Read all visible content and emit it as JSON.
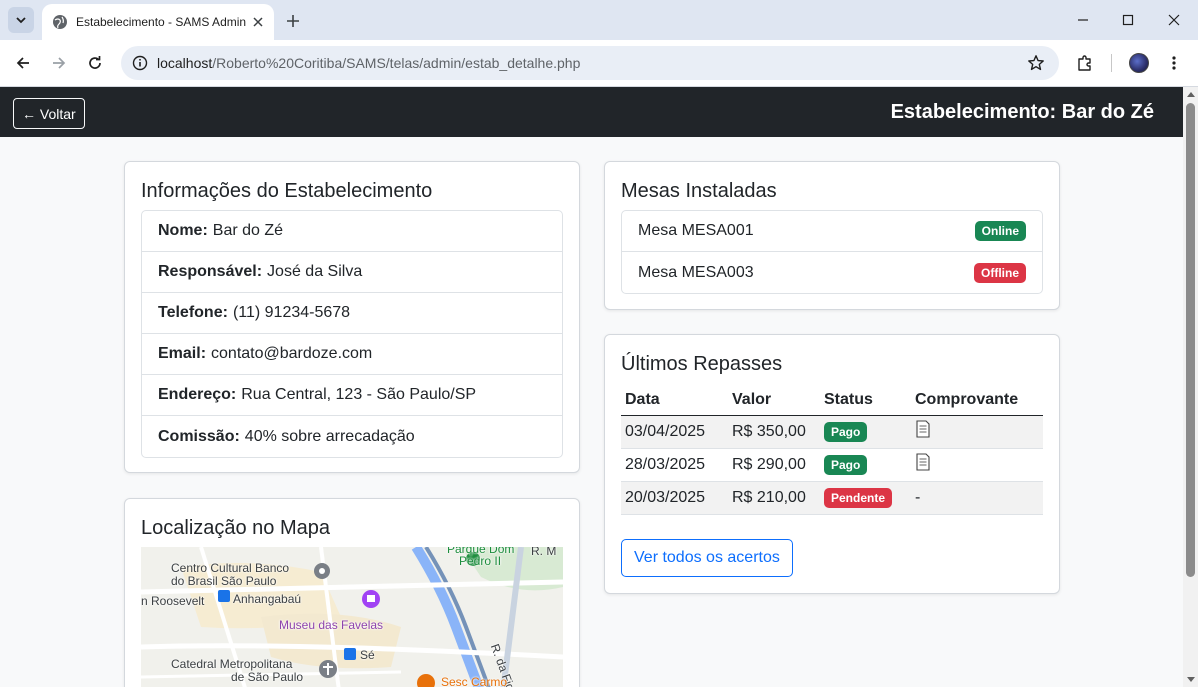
{
  "browser": {
    "tab_title": "Estabelecimento - SAMS Admin",
    "url_host": "localhost",
    "url_path": "/Roberto%20Coritiba/SAMS/telas/admin/estab_detalhe.php"
  },
  "navbar": {
    "back_label": "← Voltar",
    "title": "Estabelecimento: Bar do Zé"
  },
  "info_card": {
    "title": "Informações do Estabelecimento",
    "items": [
      {
        "label": "Nome:",
        "value": "Bar do Zé"
      },
      {
        "label": "Responsável:",
        "value": "José da Silva"
      },
      {
        "label": "Telefone:",
        "value": "(11) 91234-5678"
      },
      {
        "label": "Email:",
        "value": "contato@bardoze.com"
      },
      {
        "label": "Endereço:",
        "value": "Rua Central, 123 - São Paulo/SP"
      },
      {
        "label": "Comissão:",
        "value": "40% sobre arrecadação"
      }
    ]
  },
  "map_card": {
    "title": "Localização no Mapa",
    "labels": {
      "parque": "Parque Dom",
      "pedro": "Pedro II",
      "rm": "R. M",
      "centro1": "Centro Cultural Banco",
      "centro2": "do Brasil São Paulo",
      "roosevelt": "n Roosevelt",
      "anhangabau": "Anhangabaú",
      "museu": "Museu das Favelas",
      "figueira": "R. da Figueira",
      "catedral1": "Catedral Metropolitana",
      "catedral2": "de São Paulo",
      "se": "Sé",
      "sesc": "Sesc Carmo"
    }
  },
  "mesas_card": {
    "title": "Mesas Instaladas",
    "items": [
      {
        "name": "Mesa MESA001",
        "status": "Online",
        "status_color": "#198754"
      },
      {
        "name": "Mesa MESA003",
        "status": "Offline",
        "status_color": "#dc3545"
      }
    ]
  },
  "repasses_card": {
    "title": "Últimos Repasses",
    "headers": [
      "Data",
      "Valor",
      "Status",
      "Comprovante"
    ],
    "rows": [
      {
        "data": "03/04/2025",
        "valor": "R$ 350,00",
        "status": "Pago",
        "status_color": "#198754",
        "comprovante": "document-icon"
      },
      {
        "data": "28/03/2025",
        "valor": "R$ 290,00",
        "status": "Pago",
        "status_color": "#198754",
        "comprovante": "document-icon"
      },
      {
        "data": "20/03/2025",
        "valor": "R$ 210,00",
        "status": "Pendente",
        "status_color": "#dc3545",
        "comprovante": "-"
      }
    ],
    "button_label": "Ver todos os acertos"
  }
}
